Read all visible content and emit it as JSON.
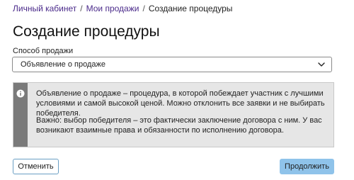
{
  "breadcrumb": {
    "items": [
      {
        "label": "Личный кабинет"
      },
      {
        "label": "Мои продажи"
      }
    ],
    "current": "Создание процедуры",
    "separator": "/"
  },
  "page": {
    "title": "Создание процедуры"
  },
  "form": {
    "sale_method": {
      "label": "Способ продажи",
      "selected": "Объявление о продаже"
    }
  },
  "info": {
    "paragraph1": "Объявление о продаже – процедура, в которой побеждает участник с лучшими условиями и самой высокой ценой. Можно отклонить все заявки и не выбирать победителя.",
    "paragraph2": "Важно: выбор победителя – это фактически заключение договора с ним. У вас возникают взаимные права и обязанности по исполнению договора."
  },
  "actions": {
    "cancel_label": "Отменить",
    "continue_label": "Продолжить"
  },
  "colors": {
    "link": "#4a2a8a",
    "info_stripe": "#7a7a7a",
    "info_bg": "#e6e6e6",
    "primary_button": "#8fc3ea",
    "secondary_border": "#6a9fc4"
  },
  "icons": {
    "select_arrow": "chevron-down-icon",
    "info": "info-icon"
  }
}
